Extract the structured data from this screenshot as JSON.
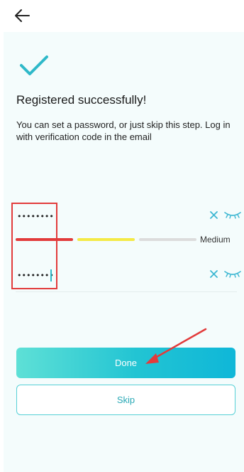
{
  "header": {
    "back_icon": "arrow-left-icon"
  },
  "status": {
    "icon": "checkmark-icon",
    "title": "Registered successfully!",
    "subtitle": "You can set a password, or just skip this step. Log in with verification code in the email"
  },
  "password": {
    "value": "••••••••",
    "clear_icon": "close-icon",
    "visibility_icon": "eye-closed-icon"
  },
  "strength": {
    "label": "Medium",
    "level": 1,
    "segments": 3
  },
  "confirm_password": {
    "value": "••••••••",
    "clear_icon": "close-icon",
    "visibility_icon": "eye-closed-icon"
  },
  "actions": {
    "done_label": "Done",
    "skip_label": "Skip"
  },
  "colors": {
    "accent": "#2fb9c9",
    "strength_active": "#e23b3b",
    "strength_medium": "#f4ea45",
    "strength_inactive": "#dcdcdc",
    "annotation": "#e23b3b"
  }
}
